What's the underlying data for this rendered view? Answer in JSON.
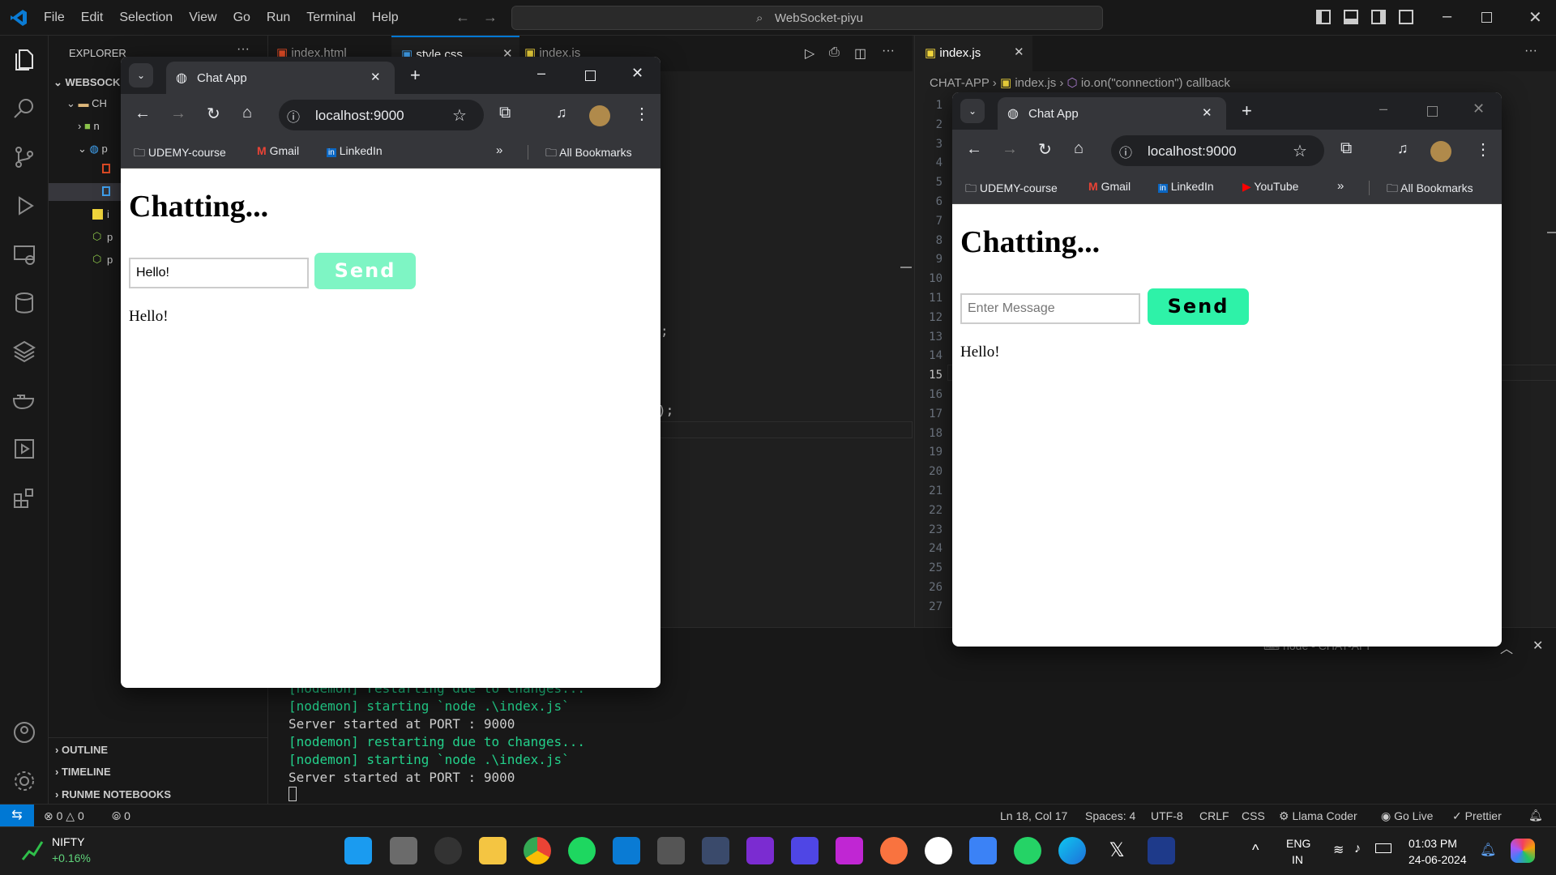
{
  "vscode": {
    "menu": [
      "File",
      "Edit",
      "Selection",
      "View",
      "Go",
      "Run",
      "Terminal",
      "Help"
    ],
    "search": "WebSocket-piyu",
    "explorer_title": "EXPLORER",
    "root_folder": "WEBSOCK",
    "sub_folder": "CH",
    "tree": [
      "n",
      "p",
      "i",
      "p",
      "p"
    ],
    "sections": [
      "OUTLINE",
      "TIMELINE",
      "RUNME NOTEBOOKS"
    ],
    "tabs": [
      "index.html",
      "style.css",
      "index.js"
    ],
    "right_tab": "index.js",
    "breadcrumb": [
      "CHAT-APP",
      "index.js",
      "io.on(\"connection\") callback"
    ],
    "line_numbers": [
      "1",
      "2",
      "3",
      "4",
      "5",
      "6",
      "7",
      "8",
      "9",
      "10",
      "11",
      "12",
      "13",
      "14",
      "15",
      "16",
      "17",
      "18",
      "19",
      "20",
      "21",
      "22",
      "23",
      "24",
      "25",
      "26",
      "27"
    ],
    "code_fragments": [
      ";",
      ");"
    ],
    "panel_title": "node - CHAT-APP",
    "terminal": [
      {
        "text": "[nodemon] restarting due to changes...",
        "color": "#23d18b"
      },
      {
        "text": "[nodemon] starting `node .\\index.js`",
        "color": "#23d18b"
      },
      {
        "text": "Server started at PORT : 9000",
        "color": "#cccccc"
      },
      {
        "text": "[nodemon] restarting due to changes...",
        "color": "#23d18b"
      },
      {
        "text": "[nodemon] starting `node .\\index.js`",
        "color": "#23d18b"
      },
      {
        "text": "Server started at PORT : 9000",
        "color": "#cccccc"
      }
    ],
    "status": {
      "errors": "0",
      "warnings": "0",
      "ports": "0",
      "position": "Ln 18, Col 17",
      "spaces": "Spaces: 4",
      "encoding": "UTF-8",
      "eol": "CRLF",
      "language": "CSS",
      "llama": "Llama Coder",
      "golive": "Go Live",
      "prettier": "Prettier"
    }
  },
  "browser_left": {
    "tab_title": "Chat App",
    "url": "localhost:9000",
    "bookmarks": [
      "UDEMY-course",
      "Gmail",
      "LinkedIn"
    ],
    "all_bookmarks": "All Bookmarks",
    "heading": "Chatting...",
    "input_value": "Hello!",
    "send_label": "Send",
    "messages": [
      "Hello!"
    ]
  },
  "browser_right": {
    "tab_title": "Chat App",
    "url": "localhost:9000",
    "bookmarks": [
      "UDEMY-course",
      "Gmail",
      "LinkedIn",
      "YouTube"
    ],
    "all_bookmarks": "All Bookmarks",
    "heading": "Chatting...",
    "input_placeholder": "Enter Message",
    "send_label": "Send",
    "messages": [
      "Hello!"
    ]
  },
  "taskbar": {
    "ticker_name": "NIFTY",
    "ticker_change": "+0.16%",
    "lang_top": "ENG",
    "lang_bottom": "IN",
    "time": "01:03 PM",
    "date": "24-06-2024"
  },
  "colors": {
    "send_active": "#2ef2a8",
    "send_disabled": "#7ef5c4",
    "vscode_blue": "#0078d4"
  }
}
